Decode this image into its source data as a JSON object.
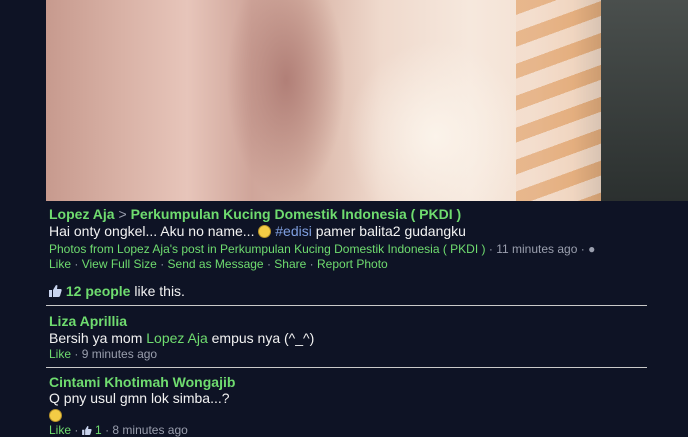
{
  "post": {
    "author": "Lopez Aja",
    "separator": ">",
    "group": "Perkumpulan Kucing Domestik Indonesia ( PKDI )",
    "caption_start": "Hai onty ongkel... Aku no name...",
    "hashtag": "#edisi",
    "caption_end": "pamer balita2 gudangku",
    "source_link": "Photos from Lopez Aja's post in Perkumpulan Kucing Domestik Indonesia ( PKDI )",
    "time": "11 minutes ago",
    "actions": [
      "Like",
      "View Full Size",
      "Send as Message",
      "Share",
      "Report Photo"
    ],
    "likes_count": "12 people",
    "likes_suffix": "like this."
  },
  "comments": [
    {
      "author": "Liza Aprillia",
      "text_start": "Bersih ya mom",
      "mention": "Lopez Aja",
      "text_end": "empus nya (^_^)",
      "like_label": "Like",
      "time": "9 minutes ago"
    },
    {
      "author": "Cintami Khotimah Wongajib",
      "text": "Q pny usul gmn lok simba...?",
      "like_label": "Like",
      "like_count": "1",
      "time": "8 minutes ago"
    }
  ]
}
